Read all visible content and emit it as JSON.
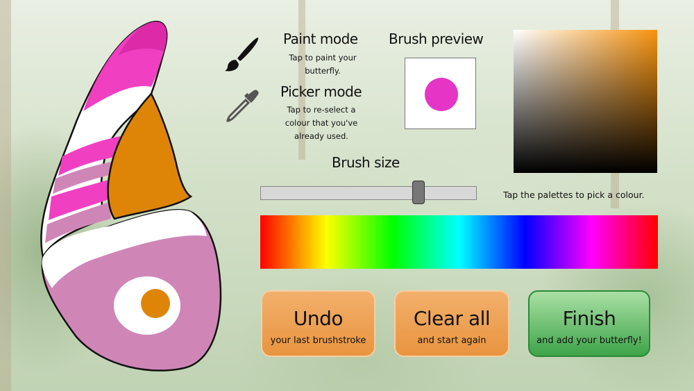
{
  "paint_mode": {
    "title": "Paint mode",
    "desc_1": "Tap to paint your",
    "desc_2": "butterfly."
  },
  "picker_mode": {
    "title": "Picker mode",
    "desc_1": "Tap to re-select a",
    "desc_2": "colour that you've",
    "desc_3": "already used."
  },
  "brush_preview": {
    "title": "Brush preview",
    "color": "#e535c7"
  },
  "brush_size": {
    "title": "Brush size",
    "value_fraction": 0.74
  },
  "palette": {
    "hint": "Tap the palettes to pick a colour.",
    "shade_base_color": "#f7930f"
  },
  "buttons": {
    "undo": {
      "label": "Undo",
      "sub": "your last brushstroke"
    },
    "clear": {
      "label": "Clear all",
      "sub": "and start again"
    },
    "finish": {
      "label": "Finish",
      "sub": "and add your butterfly!"
    }
  },
  "icons": {
    "paint": "paintbrush-icon",
    "picker": "eyedropper-icon"
  },
  "wing_colors": {
    "magenta": "#dc2aa8",
    "pink": "#f13fc2",
    "orange": "#de8507",
    "mauve": "#cf86b7",
    "white": "#ffffff"
  }
}
